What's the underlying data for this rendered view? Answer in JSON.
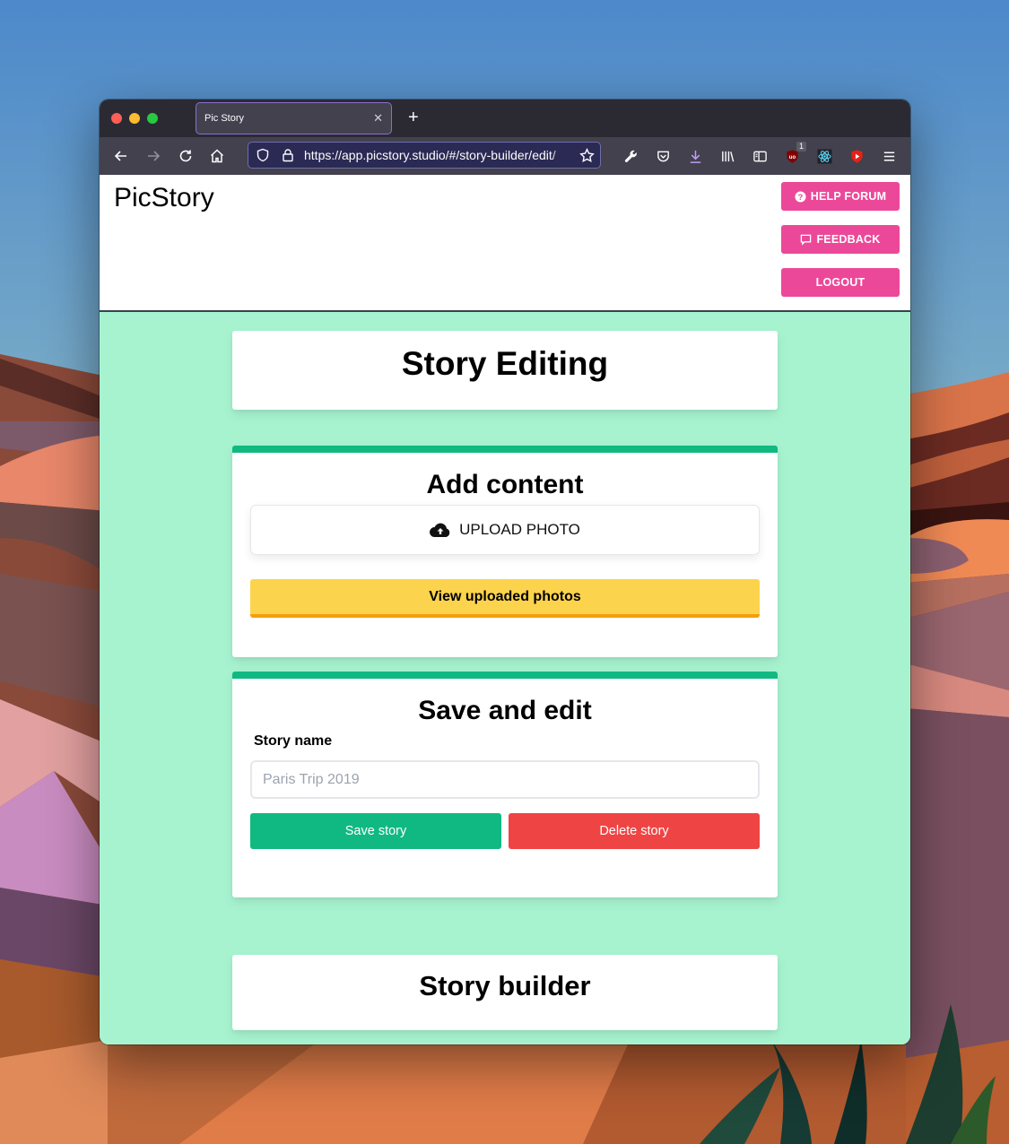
{
  "browser": {
    "tab_title": "Pic Story",
    "url": "https://app.picstory.studio/#/story-builder/edit/",
    "extension_badge": "1",
    "icons": {
      "back": "arrow-left-icon",
      "forward": "arrow-right-icon",
      "reload": "reload-icon",
      "home": "home-icon",
      "shield": "shield-icon",
      "lock": "lock-icon",
      "bookmark": "star-icon",
      "devtools": "wrench-icon",
      "pocket": "pocket-icon",
      "downloads": "download-icon",
      "library": "library-icon",
      "sidebar": "sidebar-icon",
      "ublock": "ublock-icon",
      "react_devtools": "react-icon",
      "youtube": "youtube-icon",
      "menu": "hamburger-menu-icon"
    }
  },
  "header": {
    "brand": "PicStory",
    "buttons": {
      "help_forum": "HELP FORUM",
      "feedback": "FEEDBACK",
      "logout": "LOGOUT"
    }
  },
  "main": {
    "page_title": "Story Editing",
    "add_content": {
      "title": "Add content",
      "upload_label": "UPLOAD PHOTO",
      "view_uploaded_label": "View uploaded photos"
    },
    "save_edit": {
      "title": "Save and edit",
      "story_name_label": "Story name",
      "story_name_value": "",
      "story_name_placeholder": "Paris Trip 2019",
      "save_label": "Save story",
      "delete_label": "Delete story"
    },
    "builder_title": "Story builder"
  },
  "colors": {
    "page_bg": "#a7f3d0",
    "accent_green": "#10b981",
    "pink": "#ec4899",
    "yellow": "#fcd34d",
    "yellow_border": "#f59e0b",
    "red": "#ef4444"
  }
}
